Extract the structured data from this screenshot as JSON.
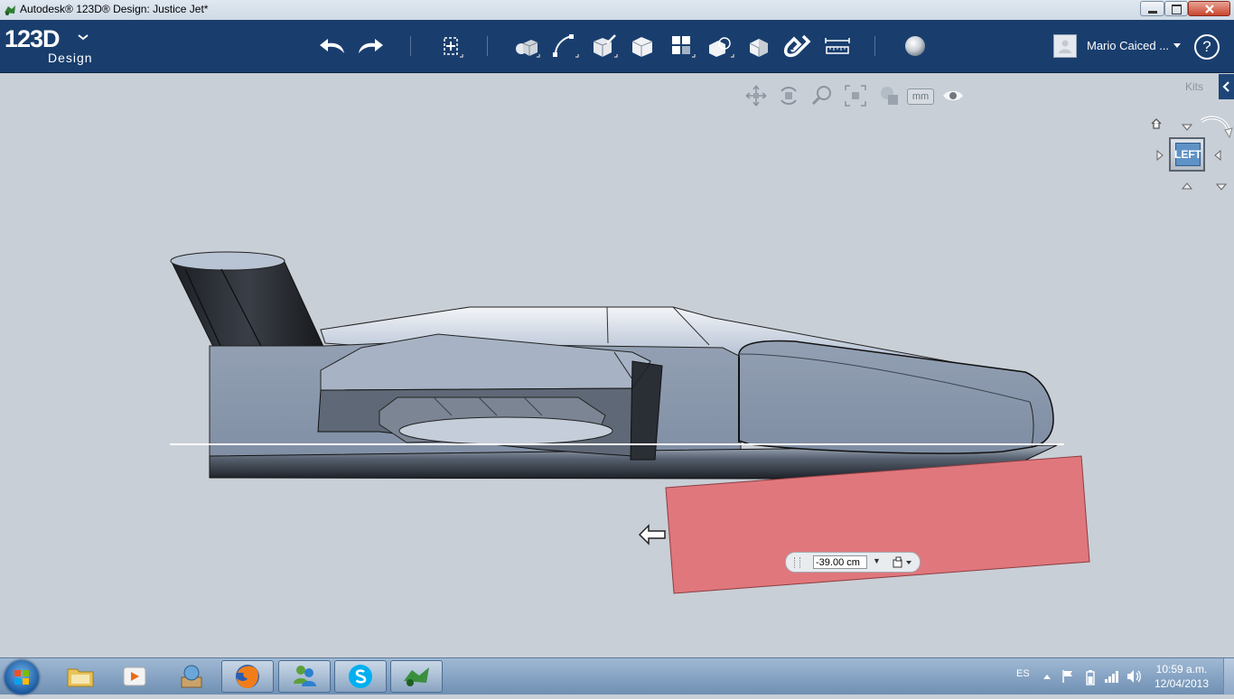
{
  "window": {
    "title": "Autodesk® 123D® Design: Justice Jet*"
  },
  "app": {
    "logo_text": "123D",
    "logo_sub": "Design",
    "user_name": "Mario Caiced ...",
    "help_label": "?"
  },
  "toolbar": {
    "icons": [
      "undo-icon",
      "redo-icon",
      "transform-icon",
      "primitives-icon",
      "sketch-icon",
      "construct-icon",
      "modify-icon",
      "pattern-icon",
      "group-icon",
      "combine-icon",
      "snap-icon",
      "measure-icon",
      "material-icon"
    ]
  },
  "canvas": {
    "kits_label": "Kits",
    "units_label": "mm",
    "viewcube_face": "LEFT",
    "dimension_value": "-39.00 cm"
  },
  "colors": {
    "header_bg": "#193e6e",
    "viewport_bg": "#c9cfd6",
    "selected_face": "#e0777d",
    "model_body": "#8795a8"
  },
  "taskbar": {
    "items": [
      "start-button",
      "file-explorer",
      "media-player",
      "app-box",
      "firefox",
      "messenger",
      "skype",
      "123d-design"
    ],
    "language": "ES",
    "time": "10:59 a.m.",
    "date": "12/04/2013"
  }
}
